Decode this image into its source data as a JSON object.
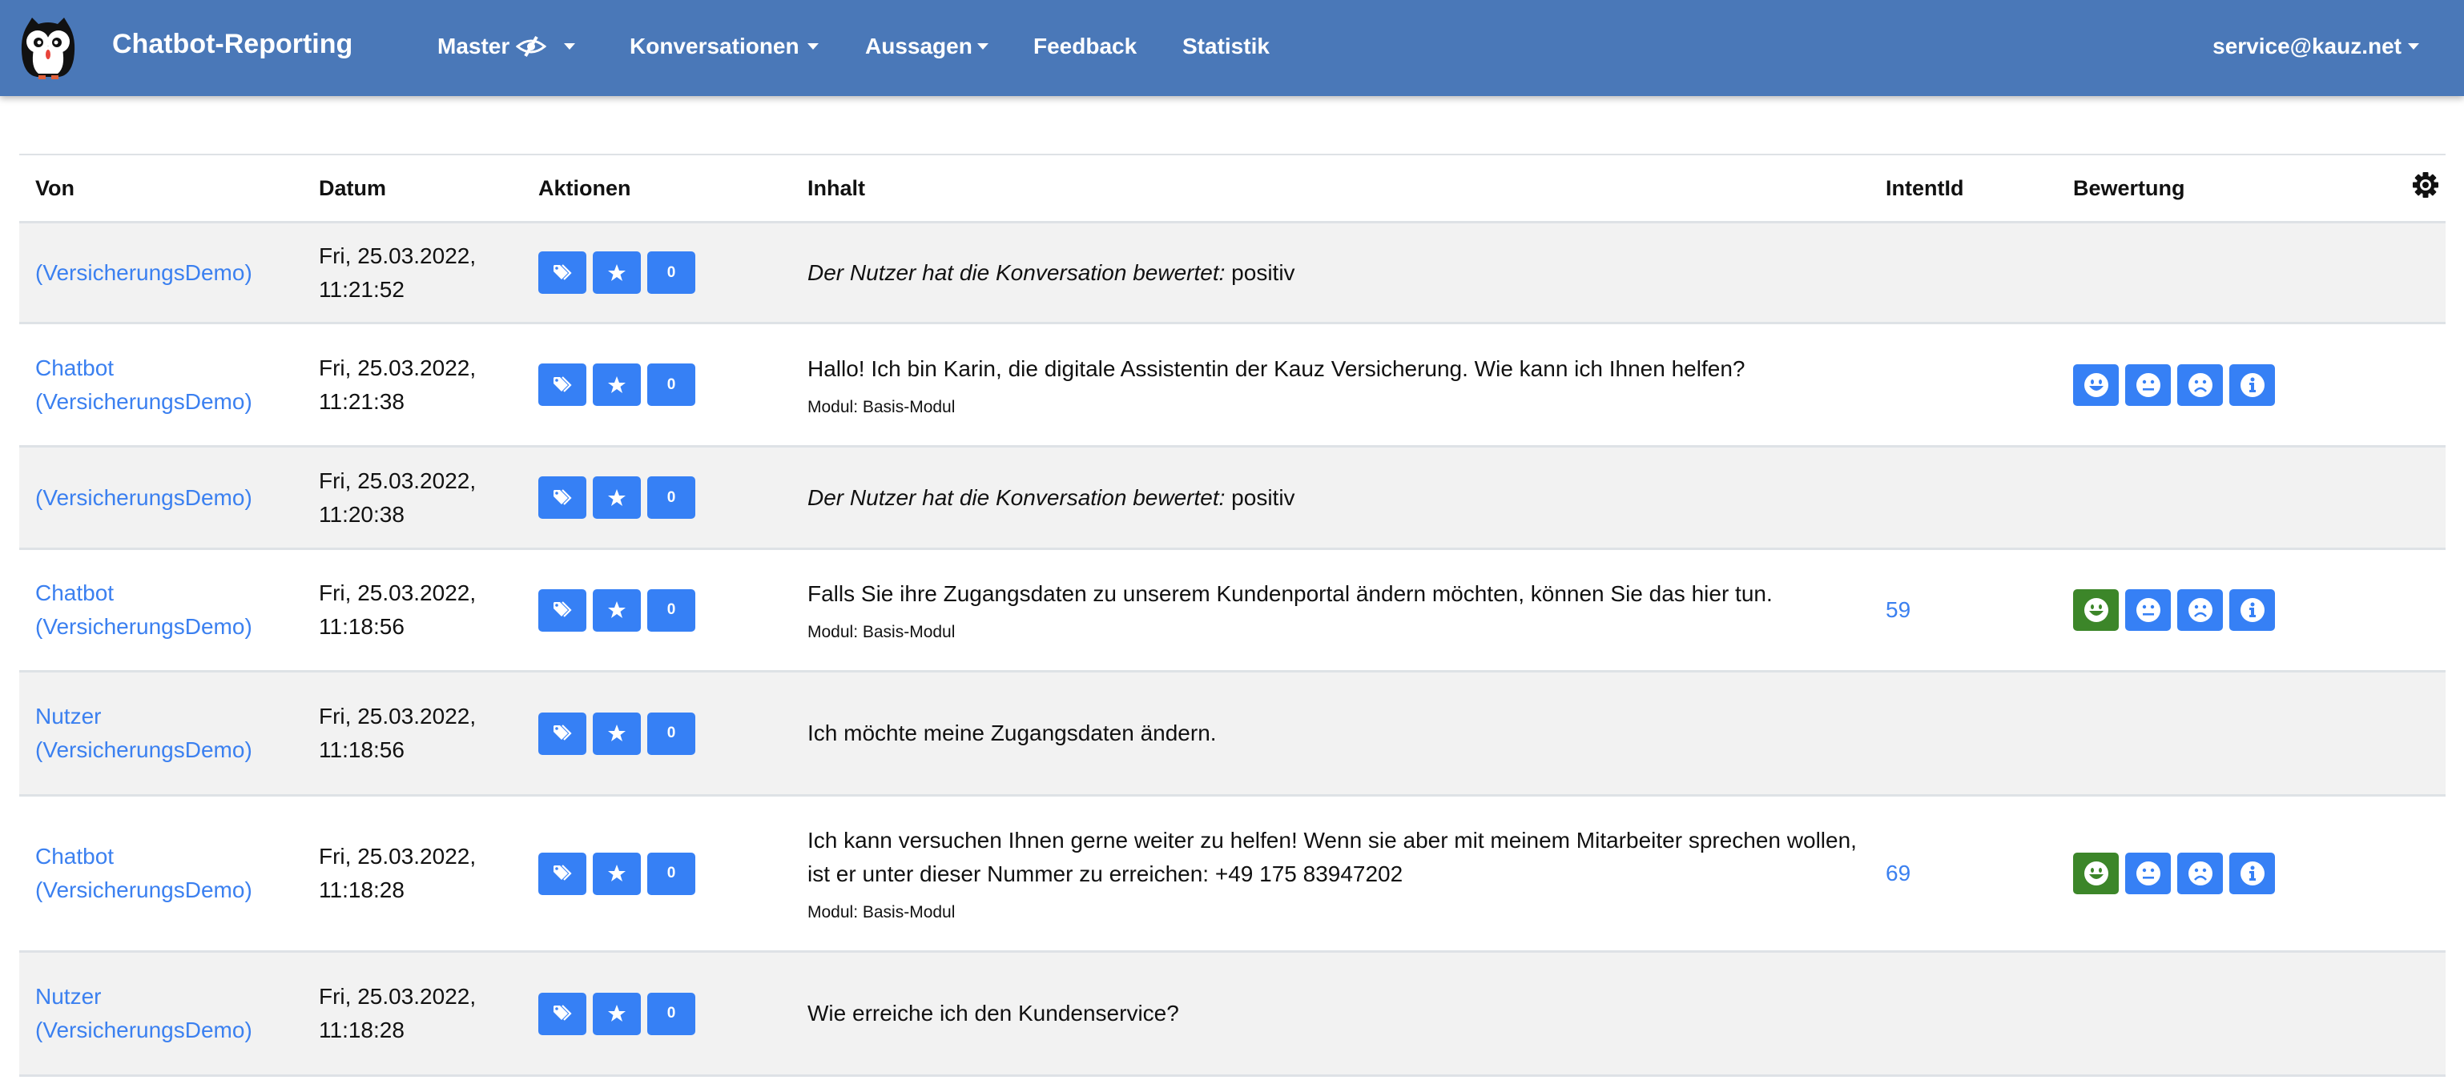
{
  "navbar": {
    "brand": "Chatbot-Reporting",
    "logo": "owl-logo",
    "items": [
      {
        "label": "Master",
        "icon": "eye-slash-icon",
        "dropdown": true
      },
      {
        "label": "Konversationen",
        "dropdown": true
      },
      {
        "label": "Aussagen",
        "dropdown": true
      },
      {
        "label": "Feedback",
        "dropdown": false
      },
      {
        "label": "Statistik",
        "dropdown": false
      }
    ],
    "user": "service@kauz.net"
  },
  "table": {
    "columns": [
      "Von",
      "Datum",
      "Aktionen",
      "Inhalt",
      "IntentId",
      "Bewertung"
    ],
    "settings_icon": "gear-icon",
    "rows": [
      {
        "von_line1": "",
        "von_line2": "(VersicherungsDemo)",
        "date_line1": "Fri, 25.03.2022,",
        "date_line2": "11:21:52",
        "count": "0",
        "content_italic": "Der Nutzer hat die Konversation bewertet:",
        "content": " positiv",
        "modul": "",
        "intent": "",
        "rating": null
      },
      {
        "von_line1": "Chatbot",
        "von_line2": "(VersicherungsDemo)",
        "date_line1": "Fri, 25.03.2022,",
        "date_line2": "11:21:38",
        "count": "0",
        "content_italic": "",
        "content": "Hallo! Ich bin Karin, die digitale Assistentin der Kauz Versicherung. Wie kann ich Ihnen helfen?",
        "modul": "Modul: Basis-Modul",
        "intent": "",
        "rating": "none"
      },
      {
        "von_line1": "",
        "von_line2": "(VersicherungsDemo)",
        "date_line1": "Fri, 25.03.2022,",
        "date_line2": "11:20:38",
        "count": "0",
        "content_italic": "Der Nutzer hat die Konversation bewertet:",
        "content": " positiv",
        "modul": "",
        "intent": "",
        "rating": null
      },
      {
        "von_line1": "Chatbot",
        "von_line2": "(VersicherungsDemo)",
        "date_line1": "Fri, 25.03.2022,",
        "date_line2": "11:18:56",
        "count": "0",
        "content_italic": "",
        "content": "Falls Sie ihre Zugangsdaten zu unserem Kundenportal ändern möchten, können Sie das hier tun.",
        "modul": "Modul: Basis-Modul",
        "intent": "59",
        "rating": "positive"
      },
      {
        "von_line1": "Nutzer",
        "von_line2": "(VersicherungsDemo)",
        "date_line1": "Fri, 25.03.2022,",
        "date_line2": "11:18:56",
        "count": "0",
        "content_italic": "",
        "content": "Ich möchte meine Zugangsdaten ändern.",
        "modul": "",
        "intent": "",
        "rating": null
      },
      {
        "von_line1": "Chatbot",
        "von_line2": "(VersicherungsDemo)",
        "date_line1": "Fri, 25.03.2022,",
        "date_line2": "11:18:28",
        "count": "0",
        "content_italic": "",
        "content": "Ich kann versuchen Ihnen gerne weiter zu helfen! Wenn sie aber mit meinem Mitarbeiter sprechen wollen, ist er unter dieser Nummer zu erreichen: +49 175 83947202",
        "modul": "Modul: Basis-Modul",
        "intent": "69",
        "rating": "positive"
      },
      {
        "von_line1": "Nutzer",
        "von_line2": "(VersicherungsDemo)",
        "date_line1": "Fri, 25.03.2022,",
        "date_line2": "11:18:28",
        "count": "0",
        "content_italic": "",
        "content": "Wie erreiche ich den Kundenservice?",
        "modul": "",
        "intent": "",
        "rating": null
      }
    ]
  },
  "colors": {
    "navbar": "#4a78b8",
    "button_primary": "#3680f5",
    "button_selected_positive": "#3c8629",
    "link": "#3b80f0",
    "row_striped": "#f2f2f2"
  }
}
